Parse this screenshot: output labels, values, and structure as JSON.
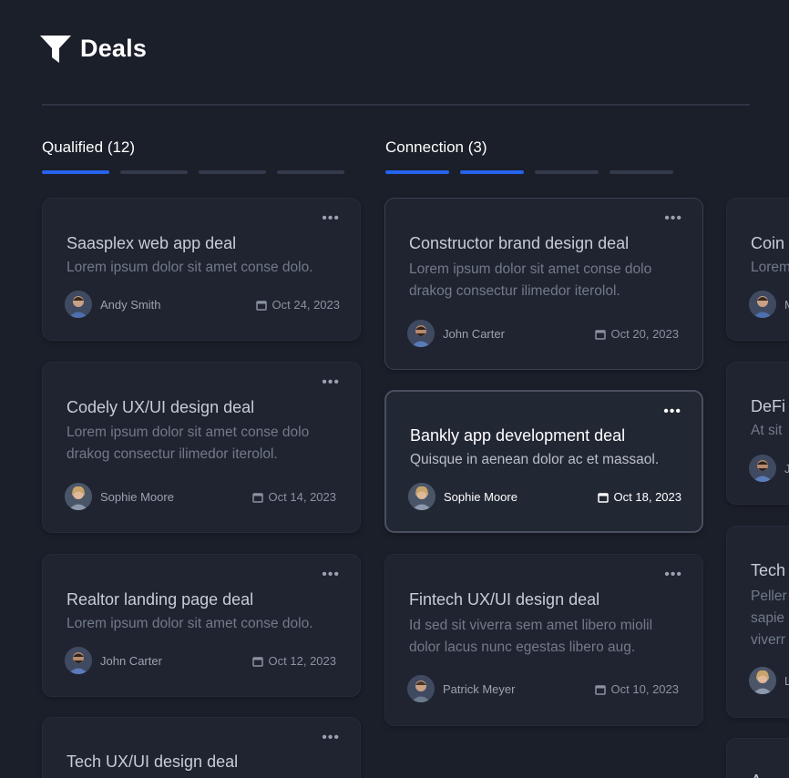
{
  "header": {
    "title": "Deals",
    "icon": "funnel-icon"
  },
  "columns": [
    {
      "title": "Qualified (12)",
      "progress": {
        "active": 1,
        "total": 4
      },
      "cards": [
        {
          "title": "Saasplex web app deal",
          "desc": "Lorem ipsum dolor sit amet conse dolo.",
          "person": "Andy Smith",
          "date": "Oct 24, 2023"
        },
        {
          "title": "Codely UX/UI design deal",
          "desc": "Lorem ipsum dolor sit amet conse dolo drakog consectur ilimedor iterolol.",
          "person": "Sophie Moore",
          "date": "Oct 14, 2023"
        },
        {
          "title": "Realtor landing page deal",
          "desc": "Lorem ipsum dolor sit amet conse dolo.",
          "person": "John Carter",
          "date": "Oct 12, 2023"
        },
        {
          "title": "Tech UX/UI design deal"
        }
      ]
    },
    {
      "title": "Connection (3)",
      "progress": {
        "active": 2,
        "total": 4
      },
      "cards": [
        {
          "title": "Constructor brand design deal",
          "desc": "Lorem ipsum dolor sit amet conse dolo drakog consectur ilimedor iterolol.",
          "person": "John Carter",
          "date": "Oct 20, 2023"
        },
        {
          "title": "Bankly app development deal",
          "desc": "Quisque in aenean dolor ac et massaol.",
          "person": "Sophie Moore",
          "date": "Oct 18, 2023"
        },
        {
          "title": "Fintech UX/UI design deal",
          "desc": "Id sed sit viverra sem amet libero miolil dolor lacus nunc egestas libero aug.",
          "person": "Patrick Meyer",
          "date": "Oct 10, 2023"
        }
      ]
    },
    {
      "cards": [
        {
          "title": "Coin",
          "desc": "Lorem",
          "person": "M"
        },
        {
          "title": "DeFi",
          "desc": "At sit",
          "person": "J"
        },
        {
          "title": "Tech",
          "desc_lines": [
            "Peller",
            "sapie",
            "viverr"
          ],
          "person": "L"
        },
        {
          "title": "A"
        }
      ]
    }
  ],
  "more_label": "•••",
  "colors": {
    "accent": "#2563eb",
    "background": "#1b1f2a",
    "card": "#1f2430"
  }
}
